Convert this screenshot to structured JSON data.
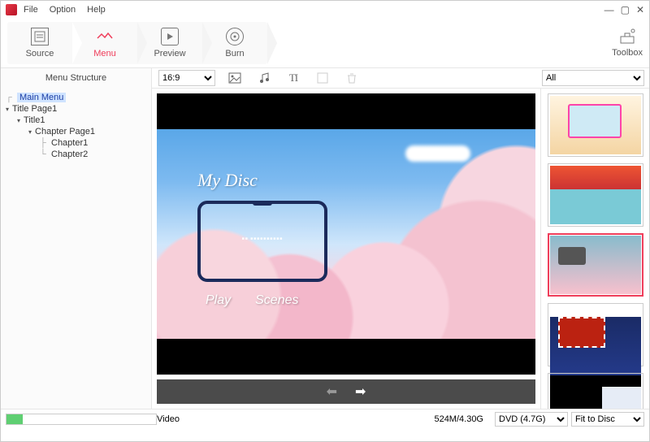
{
  "menubar": {
    "file": "File",
    "option": "Option",
    "help": "Help"
  },
  "steps": {
    "source": "Source",
    "menu": "Menu",
    "preview": "Preview",
    "burn": "Burn"
  },
  "toolbox": "Toolbox",
  "secondrow": {
    "treehead": "Menu Structure",
    "aspect": "16:9",
    "filter": "All"
  },
  "tree": {
    "main": "Main Menu",
    "titlepage": "Title Page1",
    "title": "Title1",
    "chapterpage": "Chapter Page1",
    "ch1": "Chapter1",
    "ch2": "Chapter2"
  },
  "disc": {
    "title": "My Disc",
    "play": "Play",
    "scenes": "Scenes"
  },
  "status": {
    "video": "Video",
    "size": "524M/4.30G",
    "disc": "DVD (4.7G)",
    "fit": "Fit to Disc"
  }
}
